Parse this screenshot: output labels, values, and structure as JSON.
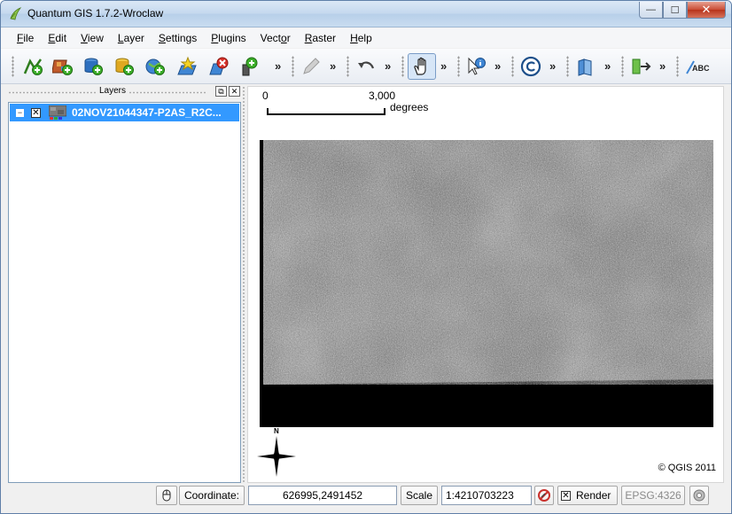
{
  "window": {
    "title": "Quantum GIS 1.7.2-Wroclaw",
    "minimize_glyph": "—",
    "maximize_glyph": "☐",
    "close_glyph": "✕"
  },
  "menu": [
    {
      "label": "File",
      "accel": "F",
      "rest": "ile"
    },
    {
      "label": "Edit",
      "accel": "E",
      "rest": "dit"
    },
    {
      "label": "View",
      "accel": "V",
      "rest": "iew"
    },
    {
      "label": "Layer",
      "accel": "L",
      "rest": "ayer"
    },
    {
      "label": "Settings",
      "accel": "S",
      "rest": "ettings"
    },
    {
      "label": "Plugins",
      "accel": "P",
      "rest": "lugins"
    },
    {
      "label": "Vector",
      "accel": "o",
      "pre": "Vect",
      "post": "r"
    },
    {
      "label": "Raster",
      "accel": "R",
      "rest": "aster"
    },
    {
      "label": "Help",
      "accel": "H",
      "rest": "elp"
    }
  ],
  "toolbar": {
    "overflow_glyph": "»",
    "icons": [
      "add-vector-layer-icon",
      "add-raster-layer-icon",
      "add-postgis-layer-icon",
      "add-spatialite-layer-icon",
      "add-wms-layer-icon",
      "new-shapefile-layer-icon",
      "remove-layer-icon",
      "add-vertex-layer-icon",
      "edit-pencil-icon",
      "undo-icon",
      "pan-hand-icon",
      "identify-icon",
      "copyright-label-icon",
      "open-book-icon",
      "move-label-icon",
      "label-abc-icon"
    ],
    "active_tool": "pan-hand-icon"
  },
  "layers_panel": {
    "title": "Layers",
    "float_glyph": "⧉",
    "close_glyph": "✕",
    "items": [
      {
        "name": "02NOV21044347-P2AS_R2C...",
        "checked": true,
        "expanded": true,
        "selected": true
      }
    ],
    "expand_glyph": "−",
    "check_glyph": "✕"
  },
  "map": {
    "scale_start": "0",
    "scale_end": "3,000",
    "scale_unit": "degrees",
    "north_label": "N",
    "copyright": "© QGIS 2011"
  },
  "statusbar": {
    "coordinate_label": "Coordinate:",
    "coordinate_value": "626995,2491452",
    "scale_label": "Scale",
    "scale_value": "1:4210703223",
    "render_label": "Render",
    "render_checked": true,
    "epsg": "EPSG:4326"
  },
  "colors": {
    "selection": "#3399ff",
    "raster_nodata": "#000000"
  }
}
